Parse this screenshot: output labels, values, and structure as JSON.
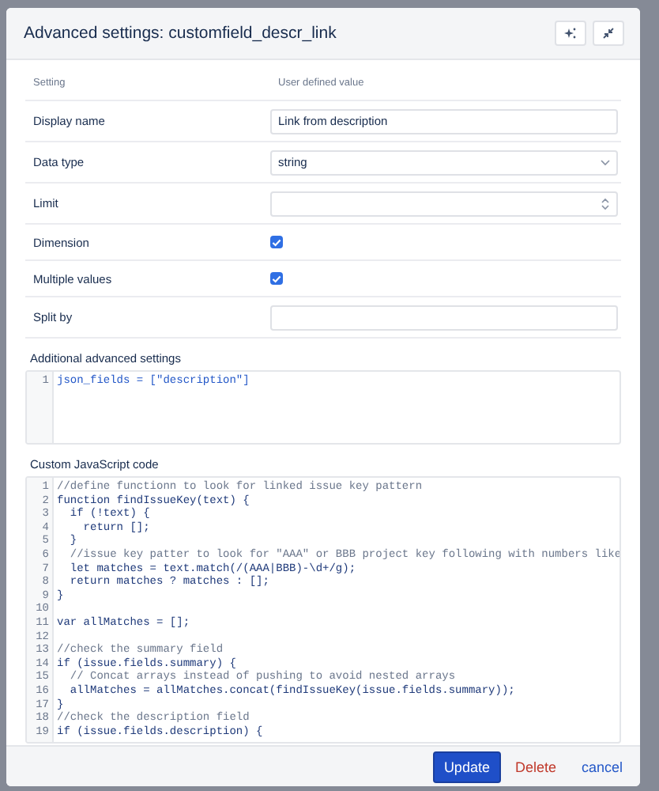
{
  "dialog": {
    "title": "Advanced settings: customfield_descr_link"
  },
  "settings": {
    "columns": [
      "Setting",
      "User defined value"
    ],
    "rows": [
      {
        "label": "Display name",
        "kind": "text",
        "value": "Link from description"
      },
      {
        "label": "Data type",
        "kind": "select",
        "value": "string"
      },
      {
        "label": "Limit",
        "kind": "number"
      },
      {
        "label": "Dimension",
        "kind": "checkbox",
        "checked": true
      },
      {
        "label": "Multiple values",
        "kind": "checkbox",
        "checked": true
      },
      {
        "label": "Split by",
        "kind": "text"
      }
    ]
  },
  "additional": {
    "heading": "Additional advanced settings",
    "lines": [
      {
        "number": "1",
        "kind": "assign",
        "text": "json_fields = [\"description\"]"
      }
    ]
  },
  "custom_code": {
    "heading": "Custom JavaScript code",
    "lines": [
      {
        "number": "1",
        "kind": "comment",
        "text": "//define functionn to look for linked issue key pattern"
      },
      {
        "number": "2",
        "kind": "code",
        "text": "function findIssueKey(text) {"
      },
      {
        "number": "3",
        "kind": "code",
        "text": "  if (!text) {"
      },
      {
        "number": "4",
        "kind": "code",
        "text": "    return [];"
      },
      {
        "number": "5",
        "kind": "code",
        "text": "  }"
      },
      {
        "number": "6",
        "kind": "comment",
        "text": "  //issue key patter to look for \"AAA\" or BBB project key following with numbers like"
      },
      {
        "number": "7",
        "kind": "code",
        "text": "  let matches = text.match(/(AAA|BBB)-\\d+/g);"
      },
      {
        "number": "8",
        "kind": "code",
        "text": "  return matches ? matches : [];"
      },
      {
        "number": "9",
        "kind": "code",
        "text": "}"
      },
      {
        "number": "10",
        "kind": "code"
      },
      {
        "number": "11",
        "kind": "code",
        "text": "var allMatches = [];"
      },
      {
        "number": "12",
        "kind": "code"
      },
      {
        "number": "13",
        "kind": "comment",
        "text": "//check the summary field"
      },
      {
        "number": "14",
        "kind": "code",
        "text": "if (issue.fields.summary) {"
      },
      {
        "number": "15",
        "kind": "comment",
        "text": "  // Concat arrays instead of pushing to avoid nested arrays"
      },
      {
        "number": "16",
        "kind": "code",
        "text": "  allMatches = allMatches.concat(findIssueKey(issue.fields.summary));"
      },
      {
        "number": "17",
        "kind": "code",
        "text": "}"
      },
      {
        "number": "18",
        "kind": "comment",
        "text": "//check the description field"
      },
      {
        "number": "19",
        "kind": "code",
        "text": "if (issue.fields.description) {"
      }
    ]
  },
  "footer": {
    "buttons": [
      {
        "label": "Update",
        "kind": "primary"
      },
      {
        "label": "Delete",
        "kind": "danger"
      },
      {
        "label": "cancel",
        "kind": "link"
      }
    ]
  }
}
